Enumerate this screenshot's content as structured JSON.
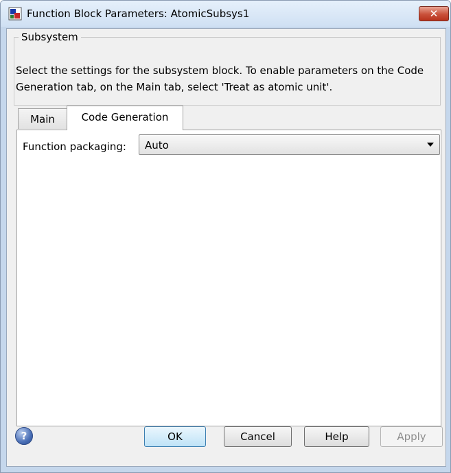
{
  "window": {
    "title": "Function Block Parameters: AtomicSubsys1",
    "close_label": "✕"
  },
  "group": {
    "label": "Subsystem",
    "description": "Select the settings for the subsystem block. To enable parameters on the Code Generation tab, on the Main tab, select 'Treat as atomic unit'."
  },
  "tabs": [
    {
      "label": "Main",
      "active": false
    },
    {
      "label": "Code Generation",
      "active": true
    }
  ],
  "code_generation": {
    "function_packaging_label": "Function packaging:",
    "function_packaging_value": "Auto"
  },
  "buttons": {
    "help_icon_glyph": "?",
    "ok": "OK",
    "cancel": "Cancel",
    "help": "Help",
    "apply": "Apply"
  }
}
